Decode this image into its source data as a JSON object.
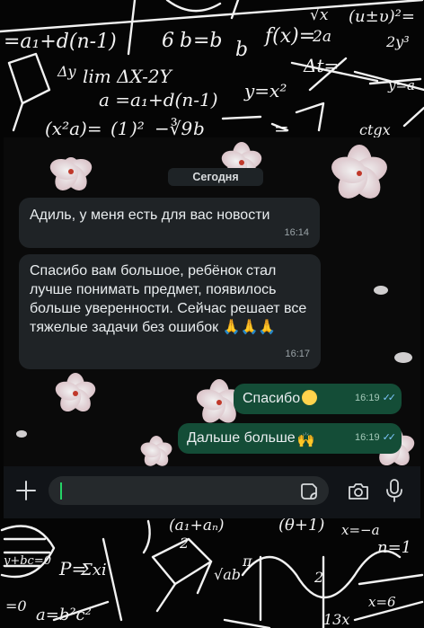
{
  "background": {
    "formulas_top": [
      "=a₁+d(n-1)",
      "6",
      "b",
      "=b",
      "b",
      "f(x)=",
      "√x",
      "2a",
      "(u±υ)²=",
      "2y³",
      "Δy",
      "lim ΔX-2Y",
      "Δt=",
      "y=a",
      "a =a₁+d(n-1)",
      "y=x²",
      "(x²a)=",
      "(1",
      ")²",
      "−∛9",
      "b",
      "=",
      "ctgx"
    ],
    "formulas_bottom": [
      "(a₁+aₙ)",
      "2",
      "(θ+1)",
      "x=−a",
      "n=1",
      "P=",
      "Σxi",
      "y+bc=0",
      "√ab",
      "π",
      "2",
      "=0",
      "a=b²c²",
      "13x",
      "x=6"
    ]
  },
  "chat": {
    "date_label": "Сегодня",
    "messages": [
      {
        "direction": "in",
        "text": "Адиль, у меня есть для вас новости",
        "time": "16:14"
      },
      {
        "direction": "in",
        "text": "Спасибо вам большое, ребёнок стал лучше понимать предмет, появилось больше уверенности. Сейчас решает все тяжелые задачи без ошибок 🙏🙏🙏",
        "time": "16:17"
      },
      {
        "direction": "out",
        "text": "Спасибо",
        "emoji": "☺️",
        "time": "16:19",
        "status": "read"
      },
      {
        "direction": "out",
        "text": "Дальше больше",
        "emoji": "🙌",
        "time": "16:19",
        "status": "read"
      }
    ],
    "read_ticks": "✓✓"
  },
  "input_bar": {
    "placeholder": "",
    "value": "",
    "icons": [
      "plus-icon",
      "sticker-icon",
      "camera-icon",
      "microphone-icon"
    ]
  },
  "colors": {
    "incoming_bubble": "#1f2326",
    "outgoing_bubble": "#144d37",
    "accent": "#25d366",
    "read_ticks": "#7ec7ff"
  }
}
